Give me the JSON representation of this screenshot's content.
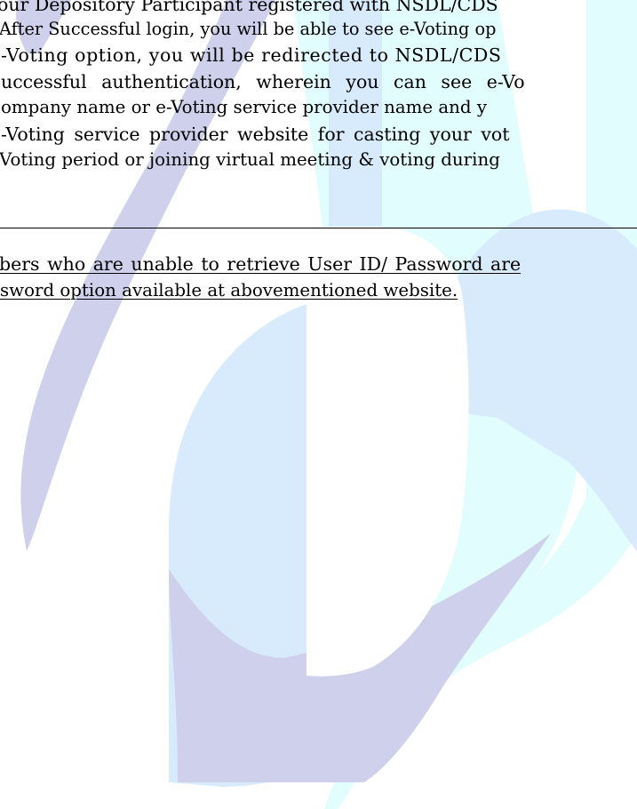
{
  "paragraph": {
    "lines": [
      "our Depository Participant registered with NSDL/CDS",
      "After Successful login, you will be able to see e-Voting op",
      "-Voting option, you will be redirected to NSDL/CDS",
      "uccessful authentication, wherein you can see e-Vo",
      "ompany name or e-Voting service provider name and y",
      "-Voting service provider website for casting your vot",
      "Voting period or joining virtual meeting & voting during"
    ]
  },
  "note": {
    "lines": [
      "bers who are unable to retrieve User ID/ Password are",
      "sword option available at abovementioned website."
    ]
  },
  "watermark": {
    "icon": "logo-watermark",
    "colors": {
      "purple": "#cfd0ec",
      "cyan": "#e2fdfd",
      "blue": "#d7ebfd"
    }
  }
}
